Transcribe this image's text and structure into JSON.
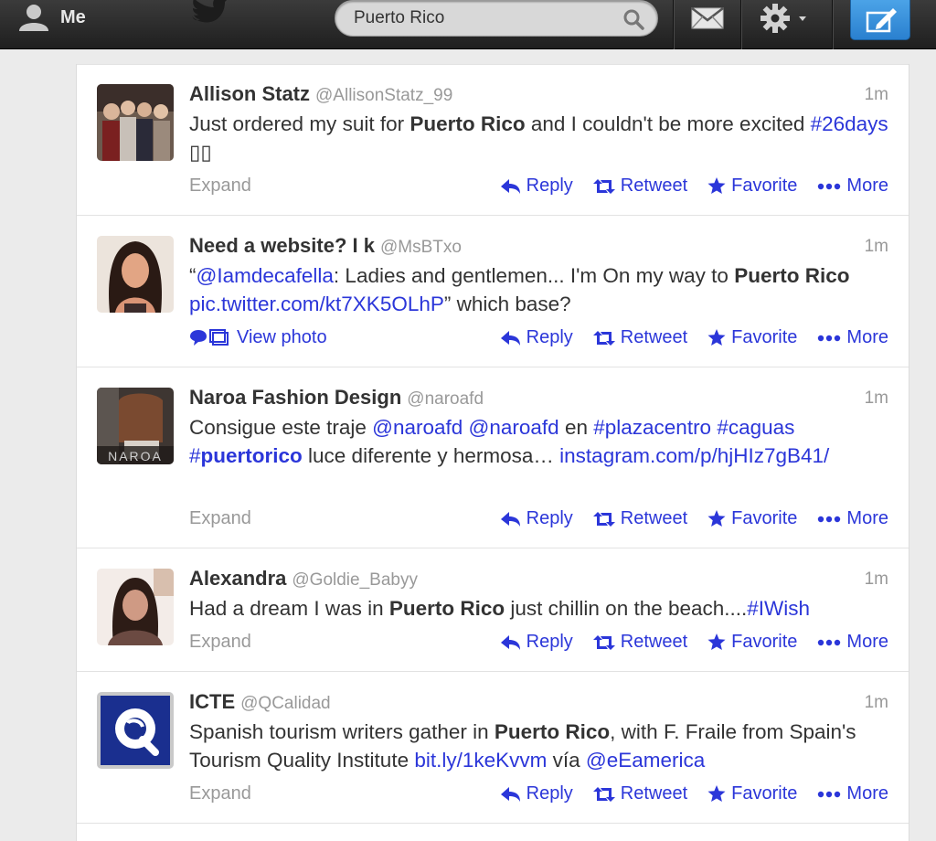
{
  "topbar": {
    "me_label": "Me",
    "search_value": "Puerto Rico",
    "icons": [
      "person-icon",
      "twitter-bird-icon",
      "search-icon",
      "mail-icon",
      "gear-icon",
      "chevron-down-icon",
      "compose-icon"
    ]
  },
  "tweets": [
    {
      "name": "Allison Statz",
      "handle": "@AllisonStatz_99",
      "time": "1m",
      "text_parts": [
        {
          "t": "Just ordered my suit for "
        },
        {
          "t": "Puerto Rico",
          "bold": true
        },
        {
          "t": " and I couldn't be more excited "
        },
        {
          "t": "#26days",
          "link": true
        },
        {
          "t": "   ▯▯"
        }
      ],
      "foot_left": "Expand"
    },
    {
      "name": "Need a website? I     k",
      "handle": "@MsBTxo",
      "time": "1m",
      "text_parts": [
        {
          "t": "“"
        },
        {
          "t": "@Iamdecafella",
          "link": true
        },
        {
          "t": ": Ladies and gentlemen... I'm On my way to "
        },
        {
          "t": "Puerto Rico",
          "bold": true
        },
        {
          "t": " "
        },
        {
          "t": "pic.twitter.com/kt7XK5OLhP",
          "link": true
        },
        {
          "t": "” which base?"
        }
      ],
      "foot_left": "View photo"
    },
    {
      "name": "Naroa Fashion Design",
      "handle": "@naroafd",
      "time": "1m",
      "text_parts": [
        {
          "t": "Consigue este traje "
        },
        {
          "t": "@naroafd",
          "link": true
        },
        {
          "t": " "
        },
        {
          "t": "@naroafd",
          "link": true
        },
        {
          "t": " en "
        },
        {
          "t": "#plazacentro",
          "link": true
        },
        {
          "t": " "
        },
        {
          "t": "#caguas",
          "link": true
        },
        {
          "t": " "
        },
        {
          "t": "#",
          "link": true
        },
        {
          "t": "puertorico",
          "link": true,
          "bold": true
        },
        {
          "t": " luce diferente y hermosa… "
        },
        {
          "t": "instagram.com/p/hjHIz7gB41/",
          "link": true
        }
      ],
      "foot_left": "Expand"
    },
    {
      "name": "Alexandra",
      "handle": "@Goldie_Babyy",
      "time": "1m",
      "text_parts": [
        {
          "t": "Had a dream I was in "
        },
        {
          "t": "Puerto Rico",
          "bold": true
        },
        {
          "t": " just chillin on the beach...."
        },
        {
          "t": "#IWish",
          "link": true
        }
      ],
      "foot_left": "Expand"
    },
    {
      "name": "ICTE",
      "handle": "@QCalidad",
      "time": "1m",
      "text_parts": [
        {
          "t": "Spanish tourism writers gather in "
        },
        {
          "t": "Puerto Rico",
          "bold": true
        },
        {
          "t": ", with F. Fraile from Spain's Tourism Quality Institute "
        },
        {
          "t": "bit.ly/1keKvvm",
          "link": true
        },
        {
          "t": " vía "
        },
        {
          "t": "@eEamerica",
          "link": true
        }
      ],
      "foot_left": "Expand"
    }
  ],
  "actions": {
    "reply": "Reply",
    "retweet": "Retweet",
    "favorite": "Favorite",
    "more": "More"
  },
  "colors": {
    "link": "#2b36d9",
    "topbar": "#2b2b2b",
    "compose": "#2f86d6"
  }
}
